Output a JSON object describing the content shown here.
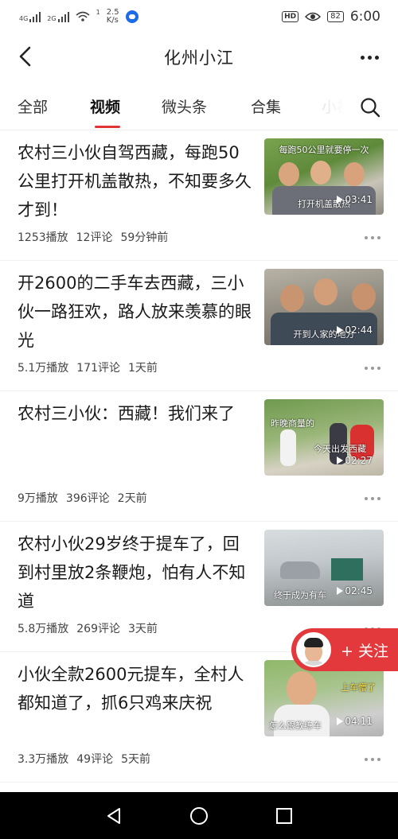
{
  "status_bar": {
    "network_1": "4G",
    "network_2": "2G",
    "wifi_extra": "1",
    "speed_value": "2.5",
    "speed_unit": "K/s",
    "hd": "HD",
    "battery": "82",
    "time": "6:00"
  },
  "header": {
    "title": "化州小江",
    "back_icon": "chevron-left-icon",
    "more_icon": "more-dots-icon"
  },
  "tabs": [
    {
      "label": "全部"
    },
    {
      "label": "视频"
    },
    {
      "label": "微头条"
    },
    {
      "label": "合集"
    },
    {
      "label": "小视"
    }
  ],
  "active_tab": "视频",
  "accent_color": "#e03535",
  "feed": [
    {
      "title": "农村三小伙自驾西藏，每跑50公里打开机盖散热，不知要多久才到！",
      "plays": "1253播放",
      "comments": "12评论",
      "time": "59分钟前",
      "thumb_top": "每跑50公里就要停一次",
      "thumb_caption": "打开机盖散热",
      "duration": "03:41"
    },
    {
      "title": "开2600的二手车去西藏，三小伙一路狂欢，路人放来羡慕的眼光",
      "plays": "5.1万播放",
      "comments": "171评论",
      "time": "1天前",
      "thumb_top": "",
      "thumb_caption": "开到人家的地方",
      "duration": "02:44"
    },
    {
      "title": "农村三小伙：西藏！我们来了",
      "plays": "9万播放",
      "comments": "396评论",
      "time": "2天前",
      "thumb_top": "昨晚商量的",
      "thumb_caption": "今天出发西藏",
      "duration": "02:27"
    },
    {
      "title": "农村小伙29岁终于提车了，回到村里放2条鞭炮，怕有人不知道",
      "plays": "5.8万播放",
      "comments": "269评论",
      "time": "3天前",
      "thumb_top": "",
      "thumb_caption": "终于成为有车",
      "duration": "02:45"
    },
    {
      "title": "小伙全款2600元提车，全村人都知道了，抓6只鸡来庆祝",
      "plays": "3.3万播放",
      "comments": "49评论",
      "time": "5天前",
      "thumb_top": "上车懵了",
      "thumb_caption": "怎么跟教练车",
      "duration": "04:11"
    }
  ],
  "follow": {
    "label": "+ 关注"
  }
}
